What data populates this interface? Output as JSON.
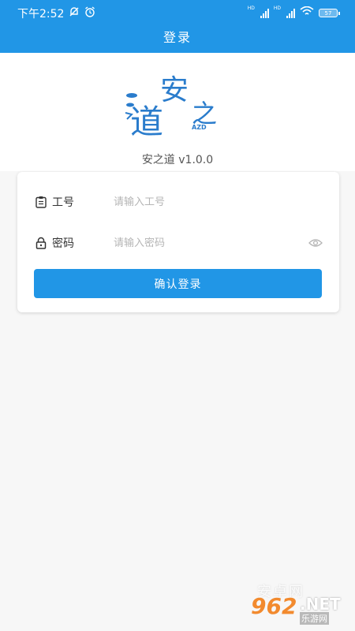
{
  "status_bar": {
    "time": "下午2:52",
    "hd1": "HD",
    "hd2": "HD",
    "battery": "57"
  },
  "header": {
    "title": "登录"
  },
  "brand": {
    "logo_an": "安",
    "logo_dao": "道",
    "logo_zhi": "之",
    "logo_azd": "AZD",
    "version": "安之道 v1.0.0"
  },
  "form": {
    "employee_label": "工号",
    "employee_placeholder": "请输入工号",
    "employee_value": "",
    "password_label": "密码",
    "password_placeholder": "请输入密码",
    "password_value": "",
    "login_button": "确认登录"
  },
  "watermark": {
    "top": "安卓网",
    "number": "962",
    "net": ".NET",
    "cn": "乐游网"
  },
  "colors": {
    "primary": "#2196e6",
    "logo_blue": "#2a7ccc",
    "background": "#f7f7f7",
    "watermark_orange": "#f28a2e"
  },
  "icons": [
    "notification-off-icon",
    "alarm-icon",
    "signal-icon",
    "wifi-icon",
    "battery-icon",
    "clipboard-icon",
    "lock-icon",
    "eye-icon"
  ]
}
